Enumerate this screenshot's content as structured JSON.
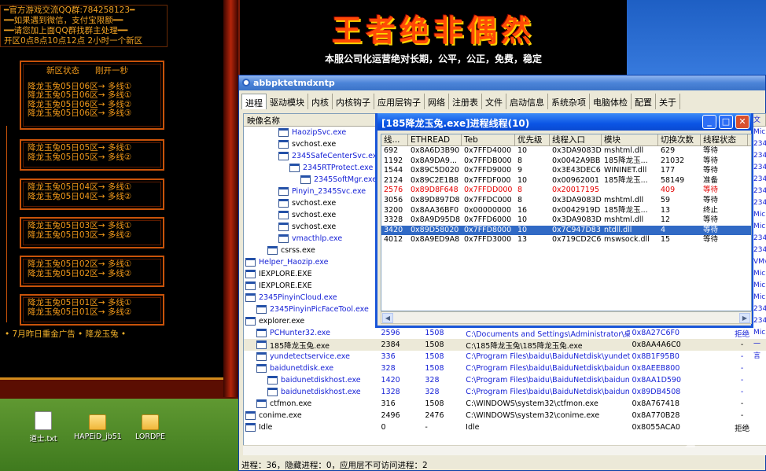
{
  "webpage": {
    "qq_lines": [
      "━官方游戏交流QQ群:784258123━",
      "━━如果遇到微信，支付宝限额━━",
      "━━请您加上面QQ群找群主处理━━",
      "开区0点8点10点12点 2小时一个新区"
    ],
    "status_header": {
      "left": "新区状态",
      "right": "刚开一秒"
    },
    "sections": [
      [
        "降龙玉兔05日06区→ 多线①",
        "降龙玉兔05日06区→ 多线①",
        "降龙玉兔05日06区→ 多线②",
        "降龙玉兔05日06区→ 多线③"
      ],
      [
        "降龙玉兔05日05区→ 多线①",
        "降龙玉兔05日05区→ 多线②"
      ],
      [
        "降龙玉兔05日04区→ 多线①",
        "降龙玉兔05日04区→ 多线②"
      ],
      [
        "降龙玉兔05日03区→ 多线①",
        "降龙玉兔05日03区→ 多线②"
      ],
      [
        "降龙玉兔05日02区→ 多线①",
        "降龙玉兔05日02区→ 多线②"
      ],
      [
        "降龙玉兔05日01区→ 多线①",
        "降龙玉兔05日01区→ 多线②"
      ]
    ],
    "marquee": "• 7月昨日重金广告 • 降龙玉兔 •",
    "banner_title": "王者绝非偶然",
    "banner_sub": "本服公司化运营绝对长期，公平，公正，免费，稳定"
  },
  "desktop_icons": [
    "道士.txt",
    "HAPEiD_jb51",
    "LORDPE"
  ],
  "main_window": {
    "title": "abbpktetmdxntp",
    "tabs": [
      "进程",
      "驱动模块",
      "内核",
      "内核钩子",
      "应用层钩子",
      "网络",
      "注册表",
      "文件",
      "启动信息",
      "系统杂项",
      "电脑体检",
      "配置",
      "关于"
    ],
    "columns": [
      "映像名称",
      "",
      "",
      "",
      "",
      ""
    ],
    "right_col": [
      "文",
      "Mic",
      "234",
      "234",
      "234",
      "234",
      "234",
      "234",
      "Mic",
      "Mic",
      "234",
      "234",
      "VMv",
      "Mic",
      "Mic",
      "Mic",
      "234",
      "234",
      "Mic",
      "一言"
    ],
    "processes": [
      {
        "name": "HaozipSvc.exe",
        "indent": 3,
        "blue": true
      },
      {
        "name": "svchost.exe",
        "indent": 3,
        "blue": false
      },
      {
        "name": "2345SafeCenterSvc.exe",
        "indent": 3,
        "blue": true
      },
      {
        "name": "2345RTProtect.exe",
        "indent": 4,
        "blue": true
      },
      {
        "name": "2345SoftMgr.exe",
        "indent": 5,
        "blue": true
      },
      {
        "name": "Pinyin_2345Svc.exe",
        "indent": 3,
        "blue": true
      },
      {
        "name": "svchost.exe",
        "indent": 3,
        "blue": false
      },
      {
        "name": "svchost.exe",
        "indent": 3,
        "blue": false
      },
      {
        "name": "svchost.exe",
        "indent": 3,
        "blue": false
      },
      {
        "name": "vmacthlp.exe",
        "indent": 3,
        "blue": true
      },
      {
        "name": "csrss.exe",
        "indent": 2,
        "blue": false
      },
      {
        "name": "Helper_Haozip.exe",
        "indent": 0,
        "blue": true
      },
      {
        "name": "IEXPLORE.EXE",
        "indent": 0,
        "blue": false
      },
      {
        "name": "IEXPLORE.EXE",
        "indent": 0,
        "blue": false
      },
      {
        "name": "2345PinyinCloud.exe",
        "indent": 0,
        "blue": true
      },
      {
        "name": "2345PinyinPicFaceTool.exe",
        "indent": 1,
        "blue": true
      },
      {
        "name": "explorer.exe",
        "indent": 0,
        "blue": false
      }
    ],
    "bottom_processes": [
      {
        "name": "PCHunter32.exe",
        "pid": "2596",
        "ppid": "1508",
        "path": "C:\\Documents and Settings\\Administrator\\桌...",
        "eproc": "0x8A27C6F0",
        "access": "拒绝",
        "blue": true,
        "indent": 1
      },
      {
        "name": "185降龙玉兔.exe",
        "pid": "2384",
        "ppid": "1508",
        "path": "C:\\185降龙玉兔\\185降龙玉兔.exe",
        "eproc": "0x8AA4A6C0",
        "access": "-",
        "blue": false,
        "indent": 1
      },
      {
        "name": "yundetectservice.exe",
        "pid": "336",
        "ppid": "1508",
        "path": "C:\\Program Files\\baidu\\BaiduNetdisk\\yundet...",
        "eproc": "0x8B1F95B0",
        "access": "-",
        "blue": true,
        "indent": 1
      },
      {
        "name": "baidunetdisk.exe",
        "pid": "328",
        "ppid": "1508",
        "path": "C:\\Program Files\\baidu\\BaiduNetdisk\\baidun...",
        "eproc": "0x8AEEB800",
        "access": "-",
        "blue": true,
        "indent": 1
      },
      {
        "name": "baidunetdiskhost.exe",
        "pid": "1420",
        "ppid": "328",
        "path": "C:\\Program Files\\baidu\\BaiduNetdisk\\baidun...",
        "eproc": "0x8AA1D590",
        "access": "-",
        "blue": true,
        "indent": 2
      },
      {
        "name": "baidunetdiskhost.exe",
        "pid": "1328",
        "ppid": "328",
        "path": "C:\\Program Files\\baidu\\BaiduNetdisk\\baidun...",
        "eproc": "0x89DB4508",
        "access": "-",
        "blue": true,
        "indent": 2
      },
      {
        "name": "ctfmon.exe",
        "pid": "316",
        "ppid": "1508",
        "path": "C:\\WINDOWS\\system32\\ctfmon.exe",
        "eproc": "0x8A767418",
        "access": "-",
        "blue": false,
        "indent": 1
      },
      {
        "name": "conime.exe",
        "pid": "2496",
        "ppid": "2476",
        "path": "C:\\WINDOWS\\system32\\conime.exe",
        "eproc": "0x8A770B28",
        "access": "-",
        "blue": false,
        "indent": 0
      },
      {
        "name": "Idle",
        "pid": "0",
        "ppid": "-",
        "path": "Idle",
        "eproc": "0x8055ACA0",
        "access": "拒绝",
        "blue": false,
        "indent": 0
      }
    ],
    "bottom_right": [
      "一言",
      "",
      "",
      "",
      "",
      "",
      "Mic",
      "Mic",
      ""
    ],
    "status": "进程：36，隐藏进程：0，应用层不可访问进程：2"
  },
  "thread_dialog": {
    "title": "[185降龙玉兔.exe]进程线程(10)",
    "columns": [
      "线...",
      "ETHREAD",
      "Teb",
      "优先级",
      "线程入口",
      "模块",
      "切换次数",
      "线程状态"
    ],
    "rows": [
      [
        "692",
        "0x8A6D3B90",
        "0x7FFD4000",
        "10",
        "0x3DA9083D",
        "mshtml.dll",
        "629",
        "等待"
      ],
      [
        "1192",
        "0x8A9DA9...",
        "0x7FFDB000",
        "8",
        "0x0042A9BB",
        "185降龙玉...",
        "21032",
        "等待"
      ],
      [
        "1544",
        "0x89C5D020",
        "0x7FFD9000",
        "9",
        "0x3E43DEC6",
        "WININET.dll",
        "177",
        "等待"
      ],
      [
        "2124",
        "0x89C2E1B8",
        "0x7FFDF000",
        "10",
        "0x00962001",
        "185降龙玉...",
        "58149",
        "准备"
      ],
      [
        "2576",
        "0x89D8F648",
        "0x7FFDD000",
        "8",
        "0x20017195",
        "",
        "409",
        "等待"
      ],
      [
        "3056",
        "0x89D897D8",
        "0x7FFDC000",
        "8",
        "0x3DA9083D",
        "mshtml.dll",
        "59",
        "等待"
      ],
      [
        "3200",
        "0x8AA36BF0",
        "0x00000000",
        "16",
        "0x0042919D",
        "185降龙玉...",
        "13",
        "终止"
      ],
      [
        "3328",
        "0x8A9D95D8",
        "0x7FFD6000",
        "10",
        "0x3DA9083D",
        "mshtml.dll",
        "12",
        "等待"
      ],
      [
        "3420",
        "0x89D58020",
        "0x7FFD8000",
        "10",
        "0x7C947D83",
        "ntdll.dll",
        "4",
        "等待"
      ],
      [
        "4012",
        "0x8A9ED9A8",
        "0x7FFD3000",
        "13",
        "0x719CD2C6",
        "mswsock.dll",
        "15",
        "等待"
      ]
    ],
    "red_row": 4,
    "selected_row": 8
  },
  "colors": {
    "accent": "#1a56d8",
    "link": "#1722d6",
    "web_text": "#f39a1a"
  }
}
